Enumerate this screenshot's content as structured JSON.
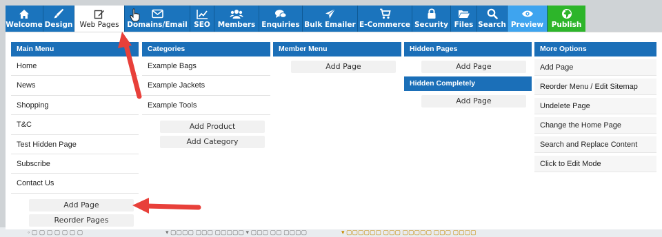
{
  "toolbar": {
    "tabs": [
      {
        "label": "Welcome",
        "icon": "home-icon"
      },
      {
        "label": "Design",
        "icon": "brush-icon"
      },
      {
        "label": "Web Pages",
        "icon": "edit-icon"
      },
      {
        "label": "Domains/Email",
        "icon": "envelope-icon"
      },
      {
        "label": "SEO",
        "icon": "chart-icon"
      },
      {
        "label": "Members",
        "icon": "users-icon"
      },
      {
        "label": "Enquiries",
        "icon": "chat-icon"
      },
      {
        "label": "Bulk Emailer",
        "icon": "send-icon"
      },
      {
        "label": "E-Commerce",
        "icon": "cart-icon"
      },
      {
        "label": "Security",
        "icon": "lock-icon"
      },
      {
        "label": "Files",
        "icon": "folder-icon"
      },
      {
        "label": "Search",
        "icon": "search-icon"
      },
      {
        "label": "Preview",
        "icon": "eye-icon"
      },
      {
        "label": "Publish",
        "icon": "globe-icon"
      }
    ],
    "active_tab": "Web Pages"
  },
  "main_menu": {
    "title": "Main Menu",
    "items": [
      "Home",
      "News",
      "Shopping",
      "T&C",
      "Test Hidden Page",
      "Subscribe",
      "Contact Us"
    ],
    "add_page": "Add Page",
    "reorder_pages": "Reorder Pages"
  },
  "categories": {
    "title": "Categories",
    "items": [
      "Example Bags",
      "Example Jackets",
      "Example Tools"
    ],
    "add_product": "Add Product",
    "add_category": "Add Category"
  },
  "member_menu": {
    "title": "Member Menu",
    "add_page": "Add Page"
  },
  "hidden_pages": {
    "title": "Hidden Pages",
    "add_page": "Add Page",
    "completely_title": "Hidden Completely",
    "completely_add_page": "Add Page"
  },
  "more_options": {
    "title": "More Options",
    "items": [
      "Add Page",
      "Reorder Menu / Edit Sitemap",
      "Undelete Page",
      "Change the Home Page",
      "Search and Replace Content",
      "Click to Edit Mode"
    ]
  },
  "colors": {
    "toolbar_blue": "#1b74bd",
    "header_blue": "#1b6fb8",
    "preview": "#3ea4ef",
    "publish": "#2db52a",
    "arrow_red": "#e8403a"
  }
}
